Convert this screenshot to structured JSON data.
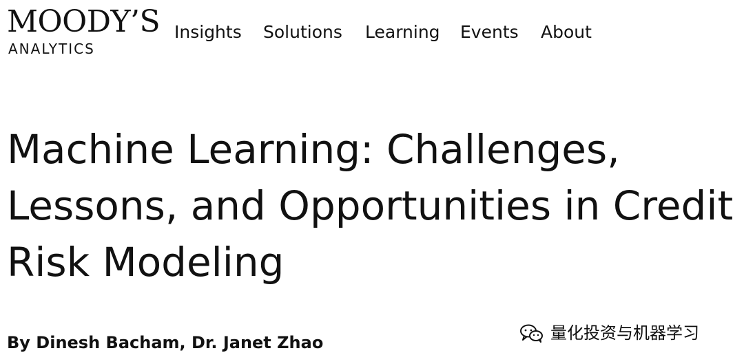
{
  "header": {
    "logo": {
      "main": "MOODY’S",
      "sub": "ANALYTICS"
    },
    "nav": [
      {
        "label": "Insights"
      },
      {
        "label": "Solutions"
      },
      {
        "label": "Learning"
      },
      {
        "label": "Events"
      },
      {
        "label": "About"
      }
    ]
  },
  "article": {
    "title": "Machine Learning: Challenges, Lessons, and Opportunities in Credit Risk Modeling",
    "byline": "By Dinesh Bacham, Dr. Janet Zhao"
  },
  "watermark": {
    "icon": "wechat-icon",
    "text": "量化投资与机器学习"
  }
}
